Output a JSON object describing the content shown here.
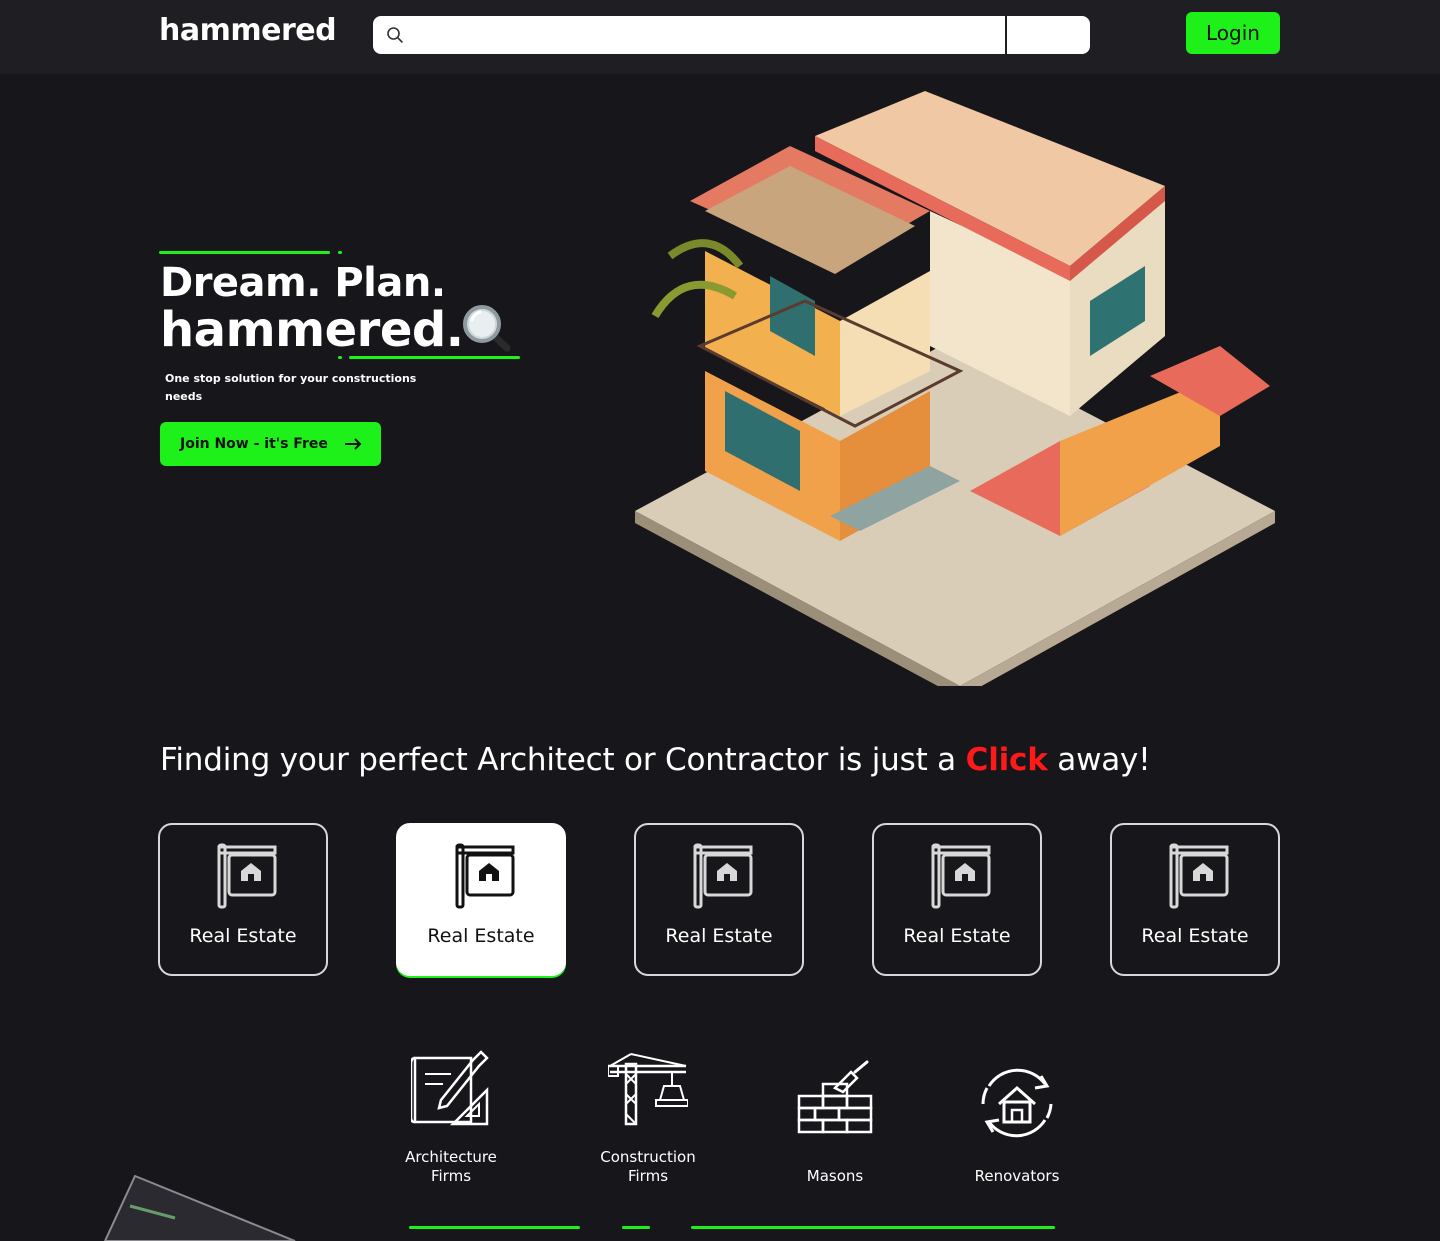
{
  "header": {
    "logo": "hammered",
    "search": {
      "placeholder": "",
      "value": ""
    },
    "login_label": "Login"
  },
  "hero": {
    "title_line1": "Dream. Plan.",
    "title_line2": "hammered.",
    "subtitle": "One stop solution for your constructions needs",
    "cta_label": "Join Now - it's Free"
  },
  "section": {
    "heading_prefix": "Finding your perfect Architect or Contractor is just a ",
    "heading_highlight": "Click",
    "heading_suffix": " away!"
  },
  "categories": [
    {
      "label": "Real Estate",
      "icon": "real-estate-sign-icon",
      "active": false
    },
    {
      "label": "Real Estate",
      "icon": "real-estate-sign-icon",
      "active": true
    },
    {
      "label": "Real Estate",
      "icon": "real-estate-sign-icon",
      "active": false
    },
    {
      "label": "Real Estate",
      "icon": "real-estate-sign-icon",
      "active": false
    },
    {
      "label": "Real Estate",
      "icon": "real-estate-sign-icon",
      "active": false
    }
  ],
  "services": [
    {
      "label_line1": "Architecture",
      "label_line2": "Firms",
      "icon": "blueprint-icon"
    },
    {
      "label_line1": "Construction",
      "label_line2": "Firms",
      "icon": "crane-icon"
    },
    {
      "label_line1": "Masons",
      "label_line2": "",
      "icon": "brick-wall-trowel-icon"
    },
    {
      "label_line1": "Renovators",
      "label_line2": "",
      "icon": "house-renovation-icon"
    }
  ],
  "colors": {
    "background": "#17161b",
    "header": "#1f1e22",
    "accent": "#1ef01a",
    "highlight": "#ff1a1a"
  }
}
